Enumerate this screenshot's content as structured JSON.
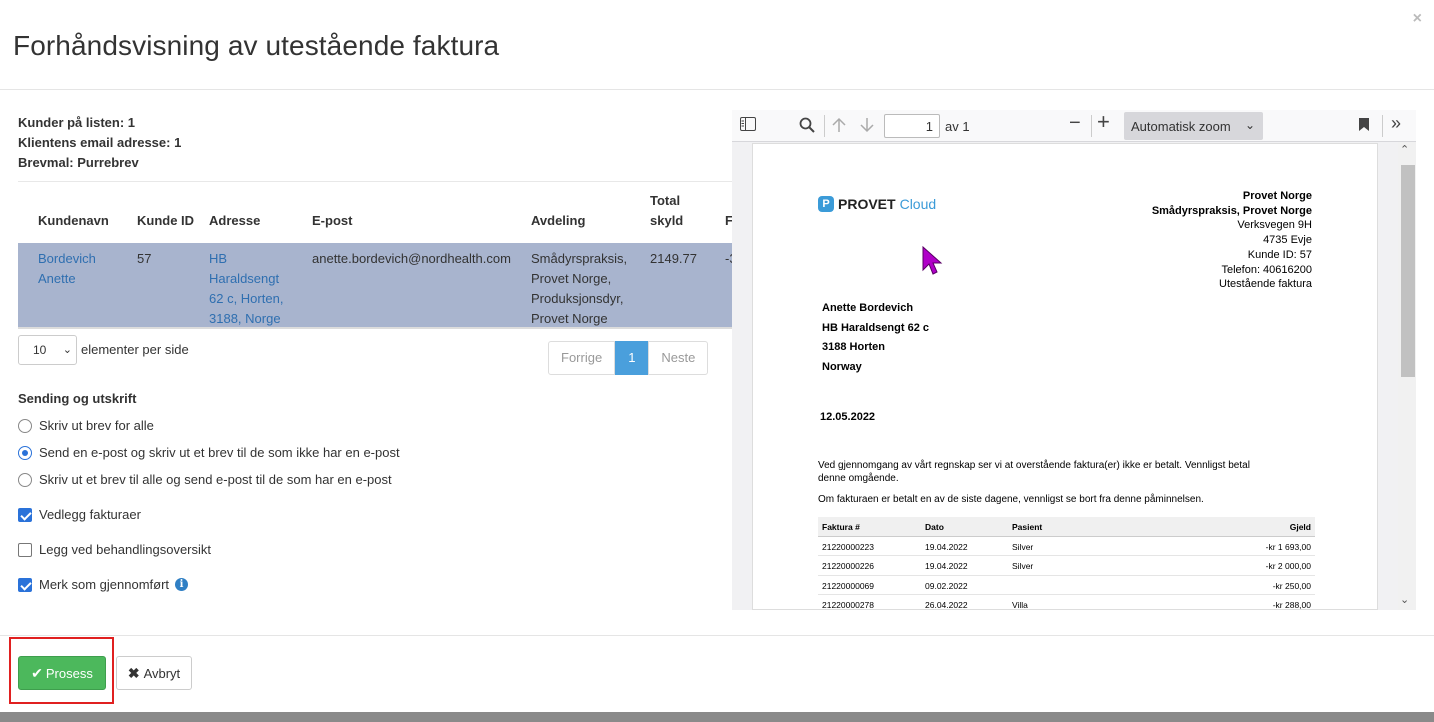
{
  "modal": {
    "title": "Forhåndsvisning av utestående faktura",
    "close": "×"
  },
  "summary": {
    "customers": "Kunder på listen: 1",
    "emails": "Klientens email adresse: 1",
    "template": "Brevmal: Purrebrev"
  },
  "table": {
    "headers": [
      "Kundenavn",
      "Kunde ID",
      "Adresse",
      "E-post",
      "Avdeling",
      "Total skyld",
      "F"
    ],
    "rows": [
      {
        "name": "Bordevich Anette",
        "id": "57",
        "address": "HB Haraldsengt 62 c, Horten, 3188, Norge",
        "email": "anette.bordevich@nordhealth.com",
        "department": "Smådyrspraksis, Provet Norge, Produksjonsdyr, Provet Norge",
        "total": "2149.77",
        "f": "-3"
      }
    ]
  },
  "pagination": {
    "page_size": "10",
    "per_page_label": "elementer per side",
    "prev": "Forrige",
    "current": "1",
    "next": "Neste"
  },
  "sending": {
    "title": "Sending og utskrift",
    "options": [
      {
        "label": "Skriv ut brev for alle",
        "selected": false
      },
      {
        "label": "Send en e-post og skriv ut et brev til de som ikke har en e-post",
        "selected": true
      },
      {
        "label": "Skriv ut et brev til alle og send e-post til de som har en e-post",
        "selected": false
      }
    ],
    "checkboxes": [
      {
        "label": "Vedlegg fakturaer",
        "checked": true
      },
      {
        "label": "Legg ved behandlingsoversikt",
        "checked": false
      },
      {
        "label": "Merk som gjennomført",
        "checked": true
      }
    ]
  },
  "footer": {
    "process": "Prosess",
    "cancel": "Avbryt"
  },
  "pdf_viewer": {
    "page": "1",
    "of": "av 1",
    "zoom": "Automatisk zoom",
    "document": {
      "logo_bold": "PROVET",
      "logo_light": "Cloud",
      "sender": [
        "Provet Norge",
        "Smådyrspraksis, Provet Norge",
        "Verksvegen 9H",
        "4735 Evje",
        "Kunde ID: 57",
        "Telefon: 40616200",
        "Utestående faktura"
      ],
      "recipient": [
        "Anette Bordevich",
        "HB Haraldsengt 62 c",
        "3188 Horten",
        "Norway"
      ],
      "date": "12.05.2022",
      "body1": "Ved gjennomgang av vårt regnskap ser vi at overstående faktura(er) ikke er betalt. Vennligst betal denne omgående.",
      "body2": "Om fakturaen er betalt en av de siste dagene, vennligst se bort fra denne påminnelsen.",
      "invoice_headers": [
        "Faktura #",
        "Dato",
        "Pasient",
        "Gjeld"
      ],
      "invoices": [
        [
          "21220000223",
          "19.04.2022",
          "Silver",
          "-kr 1 693,00"
        ],
        [
          "21220000226",
          "19.04.2022",
          "Silver",
          "-kr 2 000,00"
        ],
        [
          "21220000069",
          "09.02.2022",
          "",
          "-kr 250,00"
        ],
        [
          "21220000278",
          "26.04.2022",
          "Villa",
          "-kr 288,00"
        ]
      ]
    }
  },
  "colors": {
    "accent": "#2a72d9",
    "success": "#4cb85c",
    "selected_row": "#a8b4ce",
    "highlight": "#e02020",
    "cursor": "#b000c8"
  }
}
